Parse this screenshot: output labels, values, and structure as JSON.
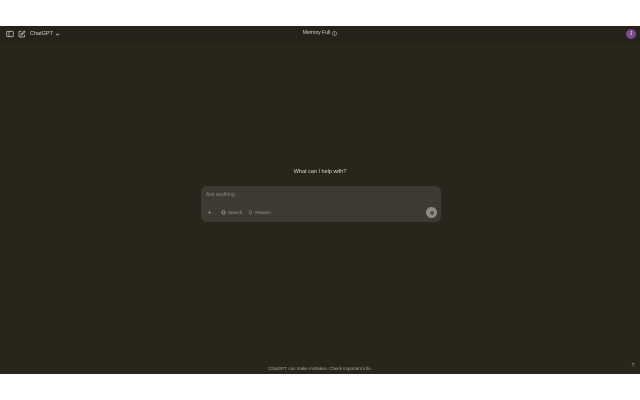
{
  "topbar": {
    "sidebar_toggle_icon": "sidebar-icon",
    "new_chat_icon": "compose-icon",
    "model_name": "ChatGPT",
    "model_chevron_icon": "chevron-down-icon",
    "title": "Memory Full",
    "title_info_icon": "info-icon",
    "avatar_initial": "J"
  },
  "main": {
    "greeting": "What can I help with?"
  },
  "composer": {
    "placeholder": "Ask anything",
    "plus_icon": "plus-icon",
    "search_label": "Search",
    "search_icon": "globe-icon",
    "reason_label": "Reason",
    "reason_icon": "lightbulb-icon",
    "voice_icon": "voice-wave-icon"
  },
  "footer": {
    "disclaimer": "ChatGPT can make mistakes. Check important info.",
    "help_label": "?"
  },
  "colors": {
    "background": "#29251a",
    "composer": "#3d3a33",
    "avatar": "#7a4a8e"
  }
}
